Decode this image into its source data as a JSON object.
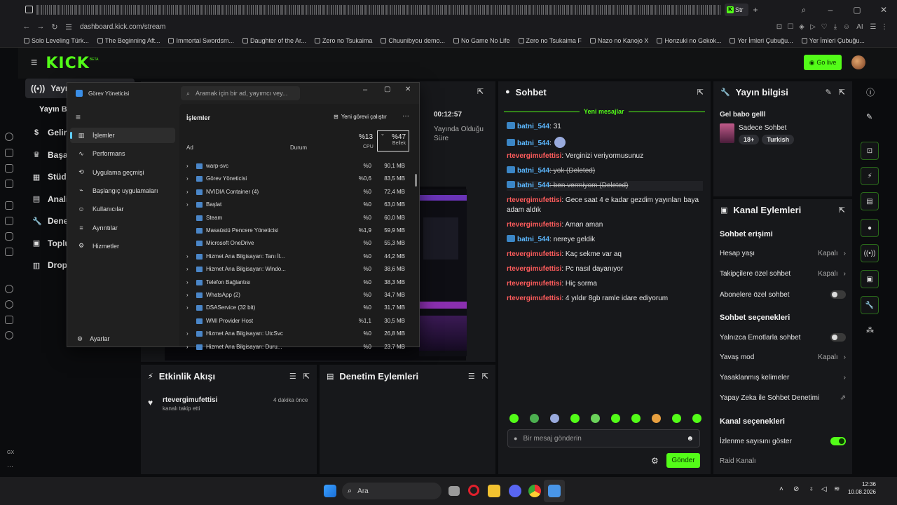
{
  "browser": {
    "active_tab_label": "Str",
    "url": "dashboard.kick.com/stream",
    "ext_ai": "AI",
    "bookmarks": [
      "Solo Leveling Türk...",
      "The Beginning Aft...",
      "Immortal Swordsm...",
      "Daughter of the Ar...",
      "Zero no Tsukaima",
      "Chuunibyou demo...",
      "No Game No Life",
      "Zero no Tsukaima F",
      "Nazo no Kanojo X",
      "Honzuki no Gekok...",
      "Yer İmleri Çubuğu...",
      "Yer İmleri Çubuğu..."
    ]
  },
  "kick": {
    "logo": "KICK",
    "go_live": "Go live",
    "sidebar": {
      "active": "Yayın",
      "sub": "Yayın Ba",
      "items": [
        "Gelir",
        "Başar",
        "Stüdy",
        "Analit",
        "Denet",
        "Toplul",
        "Dropla"
      ]
    }
  },
  "stream": {
    "timer": "00:12:57",
    "timer_label": "Yayında Olduğu Süre"
  },
  "taskmgr": {
    "title": "Görev Yöneticisi",
    "search_placeholder": "Aramak için bir ad, yayımcı vey...",
    "section_title": "İşlemler",
    "new_task": "Yeni görevi çalıştır",
    "more": "···",
    "nav": [
      "İşlemler",
      "Performans",
      "Uygulama geçmişi",
      "Başlangıç uygulamaları",
      "Kullanıcılar",
      "Ayrıntılar",
      "Hizmetler"
    ],
    "settings": "Ayarlar",
    "columns": {
      "name": "Ad",
      "status": "Durum",
      "cpu_pct": "%13",
      "cpu": "CPU",
      "mem_pct": "%47",
      "mem": "Bellek"
    },
    "rows": [
      {
        "name": "warp-svc",
        "cpu": "%0",
        "mem": "90,1 MB"
      },
      {
        "name": "Görev Yöneticisi",
        "cpu": "%0,6",
        "mem": "83,5 MB"
      },
      {
        "name": "NVIDIA Container (4)",
        "cpu": "%0",
        "mem": "72,4 MB"
      },
      {
        "name": "Başlat",
        "cpu": "%0",
        "mem": "63,0 MB"
      },
      {
        "name": "Steam",
        "cpu": "%0",
        "mem": "60,0 MB"
      },
      {
        "name": "Masaüstü Pencere Yöneticisi",
        "cpu": "%1,9",
        "mem": "59,9 MB"
      },
      {
        "name": "Microsoft OneDrive",
        "cpu": "%0",
        "mem": "55,3 MB"
      },
      {
        "name": "Hizmet Ana Bilgisayarı: Tanı İl...",
        "cpu": "%0",
        "mem": "44,2 MB"
      },
      {
        "name": "Hizmet Ana Bilgisayarı: Windo...",
        "cpu": "%0",
        "mem": "38,6 MB"
      },
      {
        "name": "Telefon Bağlantısı",
        "cpu": "%0",
        "mem": "38,3 MB"
      },
      {
        "name": "WhatsApp (2)",
        "cpu": "%0",
        "mem": "34,7 MB"
      },
      {
        "name": "DSAService (32 bit)",
        "cpu": "%0",
        "mem": "31,7 MB"
      },
      {
        "name": "WMI Provider Host",
        "cpu": "%1,1",
        "mem": "30,5 MB"
      },
      {
        "name": "Hizmet Ana Bilgisayarı: UtcSvc",
        "cpu": "%0",
        "mem": "26,8 MB"
      },
      {
        "name": "Hizmet Ana Bilgisayarı: Duru...",
        "cpu": "%0",
        "mem": "23,7 MB"
      }
    ]
  },
  "activity": {
    "title": "Etkinlik Akışı",
    "user": "rtevergimufettisi",
    "action": "kanalı takip etti",
    "time": "4 dakika önce"
  },
  "moderation": {
    "title": "Denetim Eylemleri"
  },
  "chat": {
    "title": "Sohbet",
    "new_messages": "Yeni mesajlar",
    "input_placeholder": "Bir mesaj gönderin",
    "send": "Gönder",
    "messages": [
      {
        "user": "batni_544",
        "text": ": 31",
        "type": "badge"
      },
      {
        "user": "batni_544",
        "text": ":",
        "type": "badge"
      },
      {
        "user": "rtevergimufettisi",
        "text": ": Verginizi veriyormusunuz",
        "type": "red"
      },
      {
        "user": "batni_544",
        "text": ": yok (Deleted)",
        "type": "badge"
      },
      {
        "user": "batni_544",
        "text": ": ben vermiyom (Deleted)",
        "type": "badge"
      },
      {
        "user": "rtevergimufettisi",
        "text": ": Gece saat 4 e kadar gezdim yayınları baya adam aldık",
        "type": "red"
      },
      {
        "user": "rtevergimufettisi",
        "text": ": Aman aman",
        "type": "red"
      },
      {
        "user": "batni_544",
        "text": ": nereye geldik",
        "type": "badge"
      },
      {
        "user": "rtevergimufettisi",
        "text": ": Kaç sekme var aq",
        "type": "red"
      },
      {
        "user": "rtevergimufettisi",
        "text": ": Pc nasıl dayanıyor",
        "type": "red"
      },
      {
        "user": "rtevergimufettisi",
        "text": ": Hiç sorma",
        "type": "red"
      },
      {
        "user": "rtevergimufettisi",
        "text": ": 4 yıldır 8gb ramle idare ediyorum",
        "type": "red"
      }
    ]
  },
  "info": {
    "title": "Yayın bilgisi",
    "stream_title": "Gel babo gelll",
    "category": "Sadece Sohbet",
    "tags": [
      "18+",
      "Turkish"
    ]
  },
  "channel": {
    "title": "Kanal Eylemleri",
    "chat_access": "Sohbet erişimi",
    "account_age": "Hesap yaşı",
    "followers_only": "Takipçilere özel sohbet",
    "subs_only": "Abonelere özel sohbet",
    "closed": "Kapalı",
    "chat_options": "Sohbet seçenekleri",
    "emotes_only": "Yalnızca Emotlarla sohbet",
    "slow_mode": "Yavaş mod",
    "banned_words": "Yasaklanmış kelimeler",
    "ai_mod": "Yapay Zeka ile Sohbet Denetimi",
    "channel_options": "Kanal seçenekleri",
    "show_viewers": "İzlenme sayısını göster",
    "raid": "Raid Kanalı"
  },
  "taskbar": {
    "search": "Ara",
    "time": "12:36",
    "date": "10.08.2026"
  },
  "gx_label": "GX",
  "colors": {
    "kick_green": "#53fc18",
    "panel": "#17181b",
    "chat_red": "#ff5c5c",
    "chat_blue": "#5cb8ff"
  }
}
